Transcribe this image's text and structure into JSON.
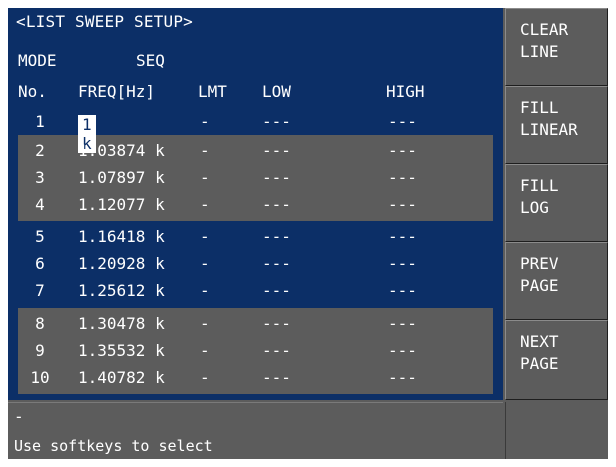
{
  "title": "<LIST SWEEP SETUP>",
  "mode": {
    "label": "MODE",
    "value": "SEQ"
  },
  "headers": {
    "no": "No.",
    "freq": "FREQ[Hz]",
    "lmt": "LMT",
    "low": "LOW",
    "high": "HIGH"
  },
  "rows": [
    {
      "no": "1",
      "freq": "1 k",
      "lmt": "-",
      "low": "---",
      "high": "---"
    },
    {
      "no": "2",
      "freq": "1.03874 k",
      "lmt": "-",
      "low": "---",
      "high": "---"
    },
    {
      "no": "3",
      "freq": "1.07897 k",
      "lmt": "-",
      "low": "---",
      "high": "---"
    },
    {
      "no": "4",
      "freq": "1.12077 k",
      "lmt": "-",
      "low": "---",
      "high": "---"
    },
    {
      "no": "5",
      "freq": "1.16418 k",
      "lmt": "-",
      "low": "---",
      "high": "---"
    },
    {
      "no": "6",
      "freq": "1.20928 k",
      "lmt": "-",
      "low": "---",
      "high": "---"
    },
    {
      "no": "7",
      "freq": "1.25612 k",
      "lmt": "-",
      "low": "---",
      "high": "---"
    },
    {
      "no": "8",
      "freq": "1.30478 k",
      "lmt": "-",
      "low": "---",
      "high": "---"
    },
    {
      "no": "9",
      "freq": "1.35532 k",
      "lmt": "-",
      "low": "---",
      "high": "---"
    },
    {
      "no": "10",
      "freq": "1.40782 k",
      "lmt": "-",
      "low": "---",
      "high": "---"
    }
  ],
  "softkeys": [
    {
      "line1": "CLEAR",
      "line2": "LINE"
    },
    {
      "line1": "FILL",
      "line2": "LINEAR"
    },
    {
      "line1": "FILL",
      "line2": "LOG"
    },
    {
      "line1": "PREV",
      "line2": "PAGE"
    },
    {
      "line1": "NEXT",
      "line2": "PAGE"
    }
  ],
  "status": {
    "input": "-",
    "message": "Use softkeys to select"
  },
  "colors": {
    "panel_blue": "#0c2f67",
    "panel_gray": "#5c5c5c",
    "text": "#ffffff"
  }
}
